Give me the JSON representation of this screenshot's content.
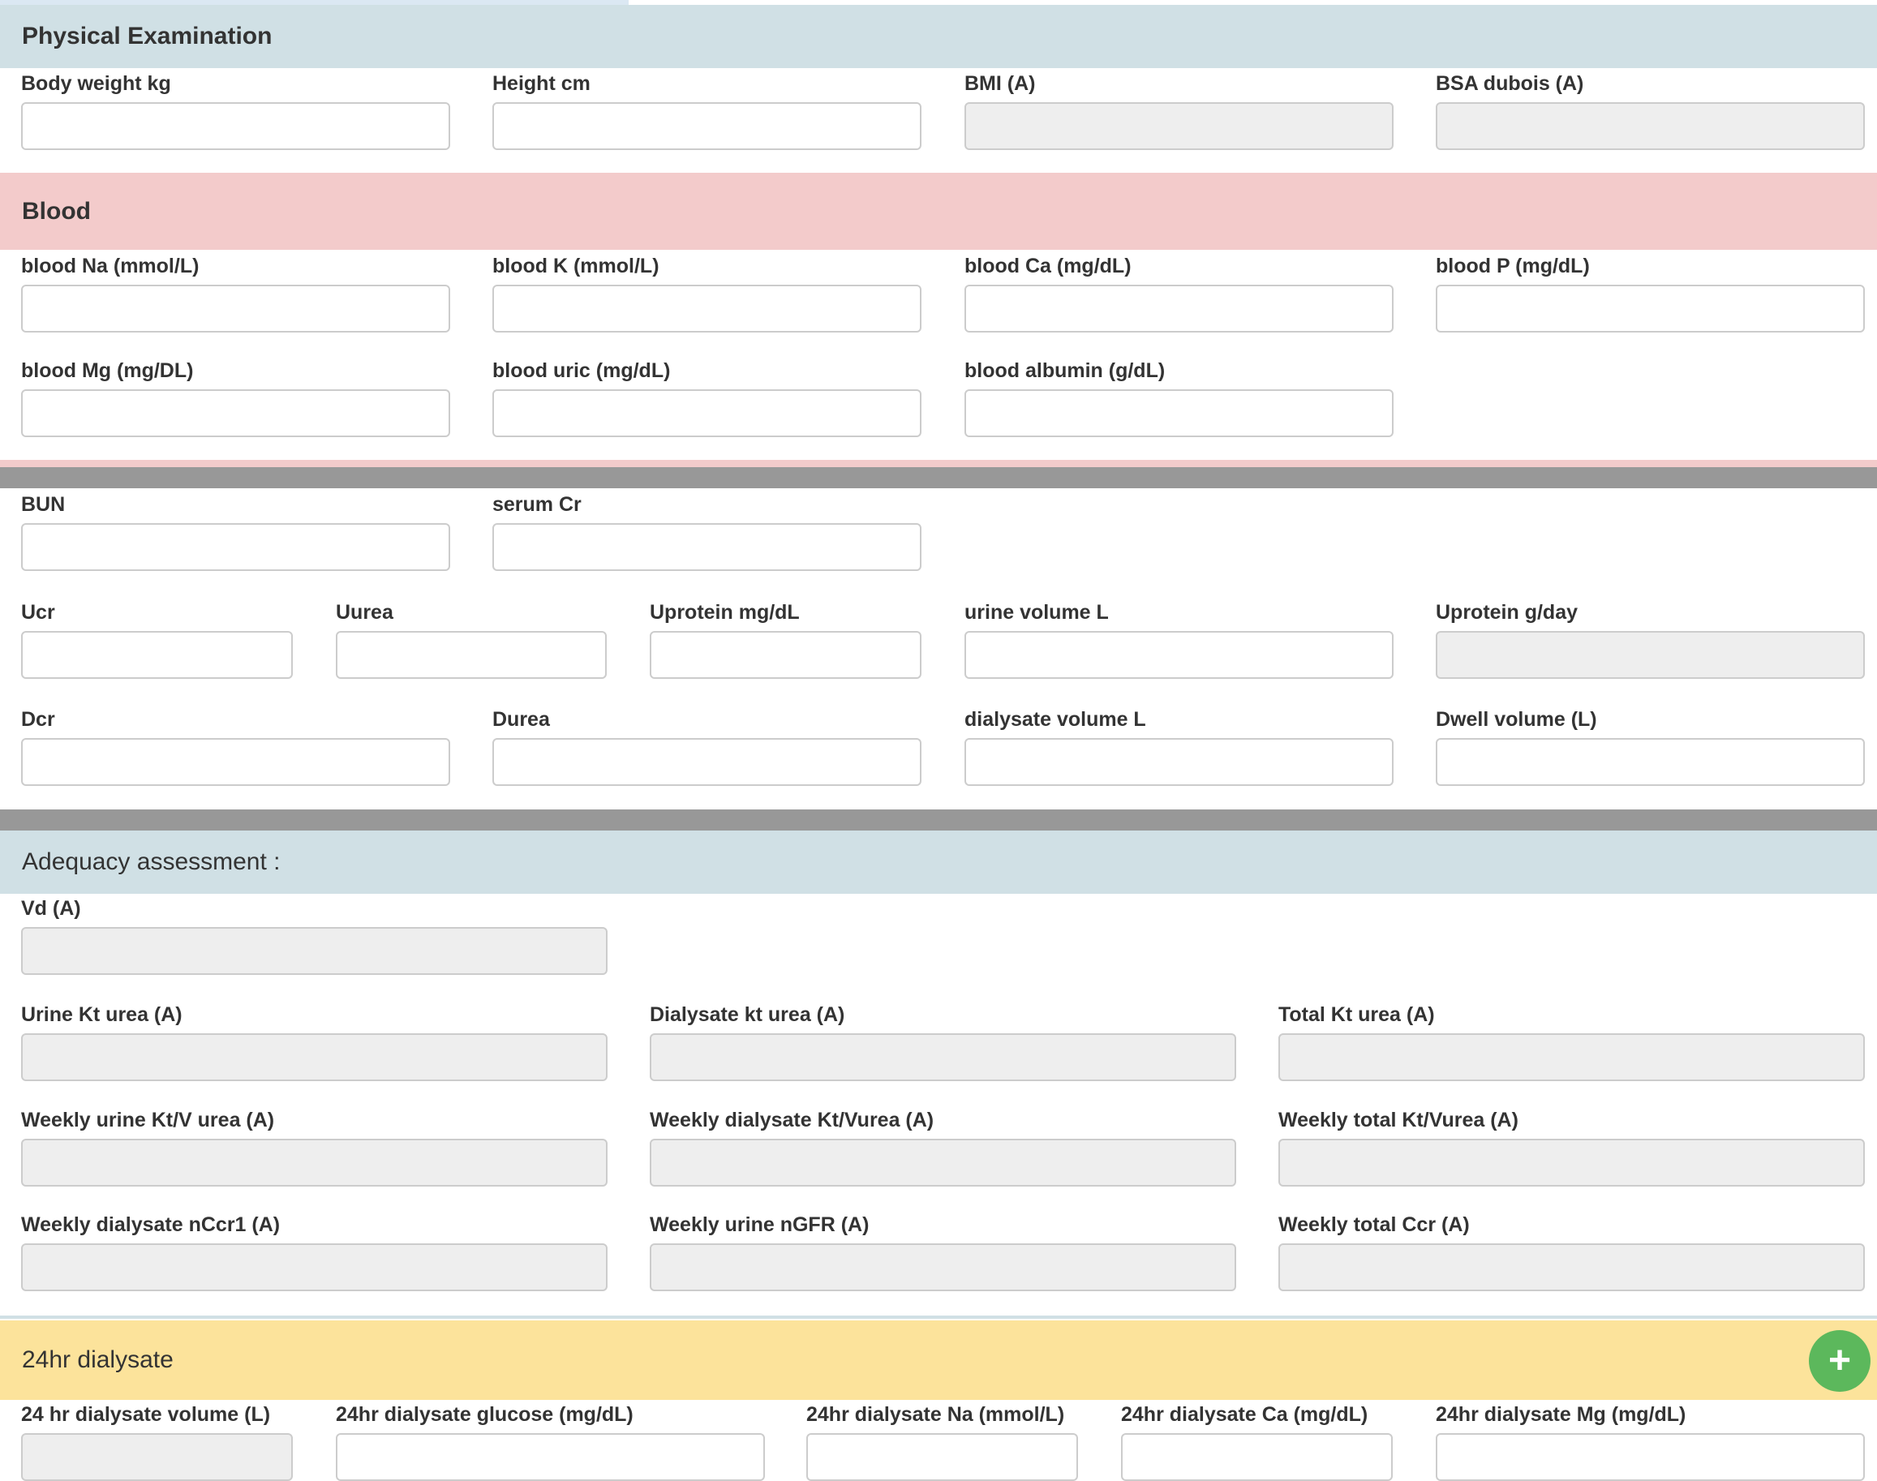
{
  "colors": {
    "physical_header": "#d0e0e5",
    "blood_header": "#f3cbcb",
    "gray_divider": "#989898",
    "adequacy_header": "#d0e0e5",
    "dialysate_header": "#fce39b",
    "add_button": "#5cb85c"
  },
  "physical": {
    "title": "Physical Examination",
    "fields": [
      {
        "label": "Body weight kg",
        "value": "",
        "readonly": false
      },
      {
        "label": "Height cm",
        "value": "",
        "readonly": false
      },
      {
        "label": "BMI (A)",
        "value": "",
        "readonly": true
      },
      {
        "label": "BSA dubois (A)",
        "value": "",
        "readonly": true
      }
    ]
  },
  "blood": {
    "title": "Blood",
    "fields": [
      {
        "label": "blood Na (mmol/L)",
        "value": ""
      },
      {
        "label": "blood K (mmol/L)",
        "value": ""
      },
      {
        "label": "blood Ca (mg/dL)",
        "value": ""
      },
      {
        "label": "blood P (mg/dL)",
        "value": ""
      },
      {
        "label": "blood Mg (mg/DL)",
        "value": ""
      },
      {
        "label": "blood uric (mg/dL)",
        "value": ""
      },
      {
        "label": "blood albumin (g/dL)",
        "value": ""
      }
    ]
  },
  "labs": {
    "fields": [
      {
        "label": "BUN",
        "value": ""
      },
      {
        "label": "serum Cr",
        "value": ""
      },
      {
        "label": "Ucr",
        "value": ""
      },
      {
        "label": "Uurea",
        "value": ""
      },
      {
        "label": "Uprotein mg/dL",
        "value": ""
      },
      {
        "label": "urine volume L",
        "value": ""
      },
      {
        "label": "Uprotein g/day",
        "value": "",
        "readonly": true
      },
      {
        "label": "Dcr",
        "value": ""
      },
      {
        "label": "Durea",
        "value": ""
      },
      {
        "label": "dialysate volume L",
        "value": ""
      },
      {
        "label": "Dwell volume (L)",
        "value": ""
      }
    ]
  },
  "adequacy": {
    "title": "Adequacy assessment :",
    "fields": [
      {
        "label": "Vd (A)",
        "value": ""
      },
      {
        "label": "Urine Kt urea (A)",
        "value": ""
      },
      {
        "label": "Dialysate kt urea (A)",
        "value": ""
      },
      {
        "label": "Total Kt urea (A)",
        "value": ""
      },
      {
        "label": "Weekly urine Kt/V urea (A)",
        "value": ""
      },
      {
        "label": "Weekly dialysate Kt/Vurea (A)",
        "value": ""
      },
      {
        "label": "Weekly total Kt/Vurea (A)",
        "value": ""
      },
      {
        "label": "Weekly dialysate nCcr1 (A)",
        "value": ""
      },
      {
        "label": "Weekly urine nGFR (A)",
        "value": ""
      },
      {
        "label": "Weekly total Ccr (A)",
        "value": ""
      }
    ]
  },
  "dialysate24": {
    "title": "24hr dialysate",
    "add_button": "+",
    "fields": [
      {
        "label": "24 hr dialysate volume (L)",
        "value": "",
        "readonly": true
      },
      {
        "label": "24hr dialysate glucose (mg/dL)",
        "value": ""
      },
      {
        "label": "24hr dialysate Na (mmol/L)",
        "value": ""
      },
      {
        "label": "24hr dialysate Ca (mg/dL)",
        "value": ""
      },
      {
        "label": "24hr dialysate Mg (mg/dL)",
        "value": ""
      }
    ]
  }
}
